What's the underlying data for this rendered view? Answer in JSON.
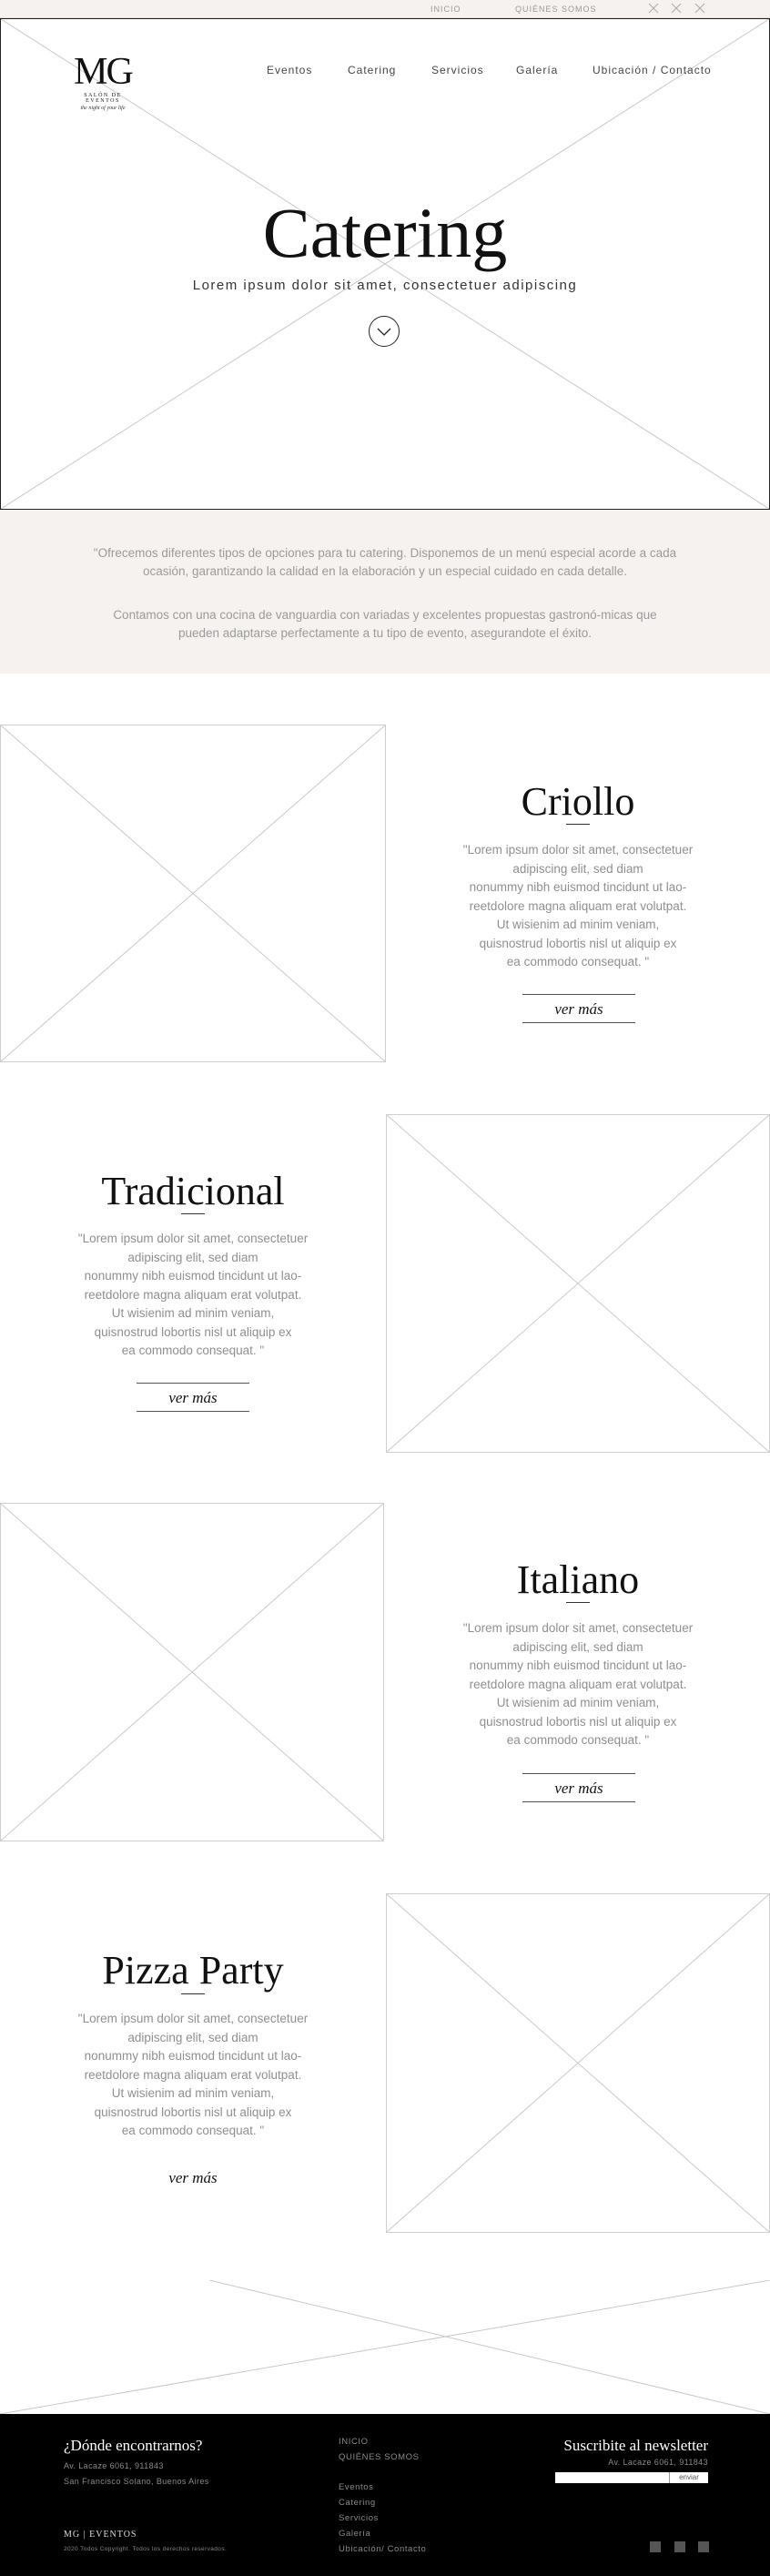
{
  "topbar": {
    "links": [
      "INICIO",
      "QUIÉNES SOMOS"
    ]
  },
  "logo": {
    "mark": "MG",
    "line1": "SALÓN DE EVENTOS",
    "line2": "the night of your life"
  },
  "nav": [
    "Eventos",
    "Catering",
    "Servicios",
    "Galería",
    "Ubicación / Contacto"
  ],
  "hero": {
    "title": "Catering",
    "subtitle": "Lorem ipsum dolor sit amet, consectetuer adipiscing"
  },
  "intro": {
    "p1": "\"Ofrecemos diferentes tipos de opciones para tu catering. Disponemos de un menú especial acorde a cada ocasión, garantizando la calidad en la elaboración y un especial cuidado en cada detalle.",
    "p2": "Contamos con una cocina de vanguardia con variadas y excelentes propuestas gastronó-micas que pueden adaptarse perfectamente a tu tipo de evento, asegurandote el éxito."
  },
  "sections": [
    {
      "title": "Criollo",
      "text": "\"Lorem ipsum dolor sit amet, consectetuer\nadipiscing elit, sed diam\nnonummy nibh euismod tincidunt ut lao-\nreetdolore magna aliquam erat volutpat.\nUt wisienim ad minim veniam,\nquisnostrud  lobortis nisl ut aliquip ex\nea commodo consequat. \"",
      "button": "ver más"
    },
    {
      "title": "Tradicional",
      "text": "\"Lorem ipsum dolor sit amet, consectetuer\nadipiscing elit, sed diam\nnonummy nibh euismod tincidunt ut lao-\nreetdolore magna aliquam erat volutpat.\nUt wisienim ad minim veniam,\nquisnostrud  lobortis nisl ut aliquip ex\nea commodo consequat. \"",
      "button": "ver más"
    },
    {
      "title": "Italiano",
      "text": "\"Lorem ipsum dolor sit amet, consectetuer\nadipiscing elit, sed diam\nnonummy nibh euismod tincidunt ut lao-\nreetdolore magna aliquam erat volutpat.\nUt wisienim ad minim veniam,\nquisnostrud  lobortis nisl ut aliquip ex\nea commodo consequat. \"",
      "button": "ver más"
    },
    {
      "title": "Pizza Party",
      "text": "\"Lorem ipsum dolor sit amet, consectetuer\nadipiscing elit, sed diam\nnonummy nibh euismod tincidunt ut lao-\nreetdolore magna aliquam erat volutpat.\nUt wisienim ad minim veniam,\nquisnostrud  lobortis nisl ut aliquip ex\nea commodo consequat. \"",
      "button": "ver más"
    }
  ],
  "footer": {
    "where_title": "¿Dónde encontrarnos?",
    "address1": "Av. Lacaze 6061, 911843",
    "address2": "San Francisco Solano, Buenos Aires",
    "links_top": [
      "INICIO",
      "QUIÉNES SOMOS"
    ],
    "links": [
      "Eventos",
      "Catering",
      "Servicios",
      "Galería",
      "Ubicación/ Contacto"
    ],
    "newsletter_title": "Suscribite al newsletter",
    "newsletter_address": "Av. Lacaze 6061, 911843",
    "newsletter_button": "enviar",
    "logo": "MG | EVENTOS",
    "copyright": "2020 Todos Copyright. Todos los derechos reservados."
  }
}
